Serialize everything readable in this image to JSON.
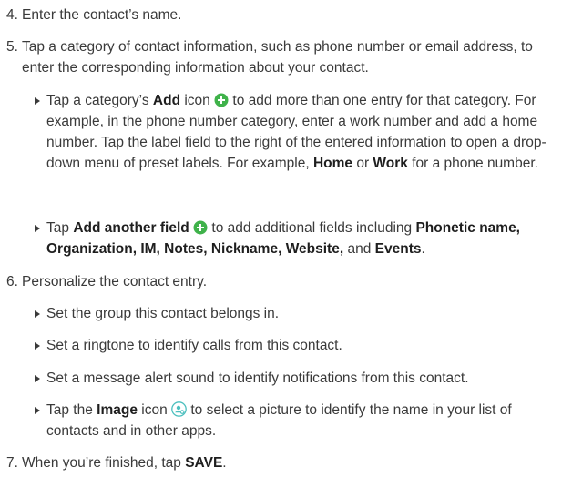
{
  "steps": {
    "s4": {
      "num": "4.",
      "text": "Enter the contact’s name."
    },
    "s5": {
      "num": "5.",
      "text": "Tap a category of contact information, such as phone number or email address, to enter the corresponding information about your contact."
    },
    "s6": {
      "num": "6.",
      "text": "Personalize the contact entry."
    },
    "s7": {
      "num": "7.",
      "pre": "When you’re finished, tap ",
      "save": "SAVE",
      "post": "."
    }
  },
  "bullets": {
    "b1": {
      "pre": "Tap a category’s ",
      "add": "Add",
      "mid": " icon ",
      "post": " to add more than one entry for that category. For example, in the phone number category, enter a work number and add a home number. Tap the label field to the right of the entered information to open a drop-down menu of preset labels. For example, ",
      "home": "Home",
      "or": " or ",
      "work": "Work",
      "end": " for a phone number."
    },
    "b2": {
      "pre": "Tap ",
      "field": "Add another field",
      "mid": " to add additional fields including ",
      "list": "Phonetic name, Organization, IM, Notes, Nickname, Website,",
      "and": " and ",
      "events": "Events",
      "end": "."
    },
    "b3": {
      "text": "Set the group this contact belongs in."
    },
    "b4": {
      "text": "Set a ringtone to identify calls from this contact."
    },
    "b5": {
      "text": "Set a message alert sound to identify notifications from this contact."
    },
    "b6": {
      "pre": "Tap the ",
      "image": "Image",
      "mid": " icon ",
      "post": " to select a picture to identify the name in your list of contacts and in other apps."
    }
  },
  "icons": {
    "plus": "plus-circle-icon",
    "image": "contact-image-icon",
    "green": "#3fb24a",
    "teal": "#4bbfbe"
  }
}
